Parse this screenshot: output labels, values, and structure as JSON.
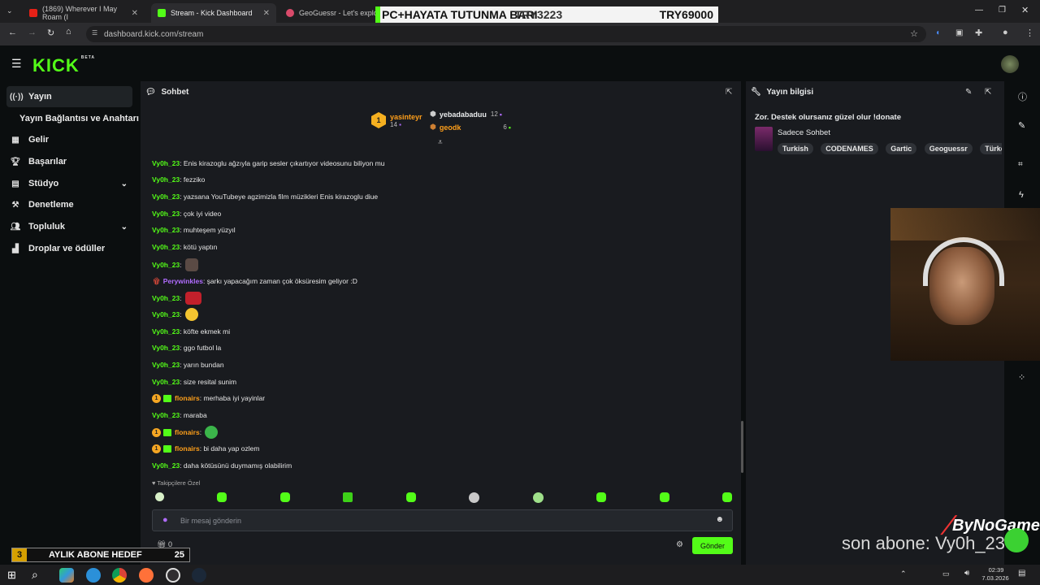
{
  "browser": {
    "tabs": [
      {
        "title": "(1869) Wherever I May Roam (I"
      },
      {
        "title": "Stream - Kick Dashboard"
      },
      {
        "title": "GeoGuessr - Let's explore th"
      }
    ],
    "url": "dashboard.kick.com/stream"
  },
  "overlay": {
    "donation_bar_left": "PC+HAYATA TUTUNMA BARI",
    "donation_bar_mid": "TRY3223",
    "donation_bar_right": "TRY69000",
    "goal_count": "3",
    "goal_label": "AYLIK ABONE HEDEF",
    "goal_target": "25",
    "last_sub": "son abone: Vy0h_23",
    "brand": "ByNoGame"
  },
  "app": {
    "logo": "KICK",
    "logo_beta": "BETA"
  },
  "sidebar": {
    "items": [
      {
        "label": "Yayın",
        "icon": "broadcast-icon"
      },
      {
        "label": "Yayın Bağlantısı ve Anahtarı",
        "icon": ""
      },
      {
        "label": "Gelir",
        "icon": "dollar-icon"
      },
      {
        "label": "Başarılar",
        "icon": "trophy-icon"
      },
      {
        "label": "Stüdyo",
        "icon": "grid-icon"
      },
      {
        "label": "Denetleme",
        "icon": "hammer-icon"
      },
      {
        "label": "Topluluk",
        "icon": "users-icon"
      },
      {
        "label": "Droplar ve ödüller",
        "icon": "gift-icon"
      }
    ]
  },
  "chat": {
    "title": "Sohbet",
    "top_gifters": [
      {
        "name": "yasinteyr",
        "count": "14"
      },
      {
        "name": "yebadabaduu",
        "count": "12"
      },
      {
        "name": "geodk",
        "count": "6"
      }
    ],
    "messages": [
      {
        "user": "Vy0h_23",
        "text": "Enis kirazoglu ağzıyla garip sesler çıkartıyor videosunu biliyon mu"
      },
      {
        "user": "Vy0h_23",
        "text": "fezziko"
      },
      {
        "user": "Vy0h_23",
        "text": "yazsana YouTubeye agzimizla film müzikleri Enis kirazoglu diue"
      },
      {
        "user": "Vy0h_23",
        "text": "çok iyi video"
      },
      {
        "user": "Vy0h_23",
        "text": "muhteşem yüzyıl"
      },
      {
        "user": "Vy0h_23",
        "text": "kötü yaptın"
      },
      {
        "user": "Vy0h_23",
        "text": ""
      },
      {
        "user": "Perywinkles",
        "text": "şarkı yapacağım zaman çok öksüresim geliyor :D"
      },
      {
        "user": "Vy0h_23",
        "text": ""
      },
      {
        "user": "Vy0h_23",
        "text": ""
      },
      {
        "user": "Vy0h_23",
        "text": "köfte ekmek mi"
      },
      {
        "user": "Vy0h_23",
        "text": "ggo futbol la"
      },
      {
        "user": "Vy0h_23",
        "text": "yarın bundan"
      },
      {
        "user": "Vy0h_23",
        "text": "size resital sunim"
      },
      {
        "user": "flonairs",
        "text": "merhaba iyi yayinlar"
      },
      {
        "user": "Vy0h_23",
        "text": "maraba"
      },
      {
        "user": "flonairs",
        "text": ""
      },
      {
        "user": "flonairs",
        "text": "bi daha yap ozlem"
      },
      {
        "user": "Vy0h_23",
        "text": "daha kötüsünü duymamış olabilirim"
      }
    ],
    "emote_section": "Takipçilere Özel",
    "input_placeholder": "Bir mesaj gönderin",
    "send_label": "Gönder",
    "gift_count": "0"
  },
  "stream_info": {
    "title": "Yayın bilgisi",
    "stream_title": "Zor. Destek olursanız güzel olur !donate",
    "category": "Sadece Sohbet",
    "tags": [
      "Turkish",
      "CODENAMES",
      "Gartic",
      "Geoguessr",
      "Türkçe"
    ]
  },
  "taskbar": {
    "time": "02:39",
    "date": "7.03.2026"
  },
  "colors": {
    "kick_green": "#53fc18",
    "panel": "#191b1f",
    "background": "#0b0e0f"
  }
}
